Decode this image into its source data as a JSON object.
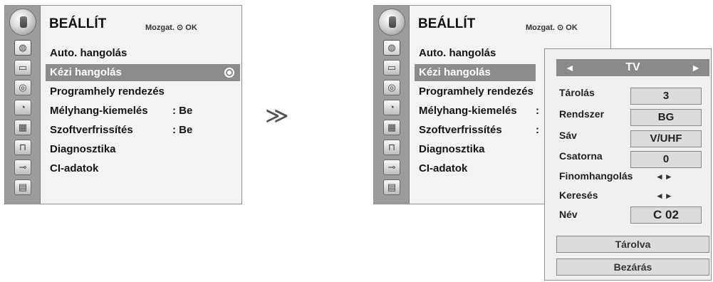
{
  "left_menu": {
    "title": "BEÁLLÍT",
    "hint": "Mozgat. ⊙ OK",
    "items": [
      {
        "label": "Auto. hangolás",
        "value": ""
      },
      {
        "label": "Kézi hangolás",
        "value": ""
      },
      {
        "label": "Programhely rendezés",
        "value": ""
      },
      {
        "label": "Mélyhang-kiemelés",
        "value": ": Be"
      },
      {
        "label": "Szoftverfrissítés",
        "value": ": Be"
      },
      {
        "label": "Diagnosztika",
        "value": ""
      },
      {
        "label": "CI-adatok",
        "value": ""
      }
    ],
    "selected_index": 1,
    "side_icons": [
      "globe-icon",
      "tv-icon",
      "speaker-icon",
      "clock-icon",
      "lock-icon",
      "padlock-icon",
      "plug-icon",
      "picture-icon"
    ]
  },
  "arrow_glyph": "≫",
  "right_menu": {
    "title": "BEÁLLÍT",
    "hint": "Mozgat. ⊙ OK",
    "items": [
      {
        "label": "Auto. hangolás",
        "value": ""
      },
      {
        "label": "Kézi hangolás",
        "value": ""
      },
      {
        "label": "Programhely rendezés",
        "value": ""
      },
      {
        "label": "Mélyhang-kiemelés",
        "value": ":"
      },
      {
        "label": "Szoftverfrissítés",
        "value": ":"
      },
      {
        "label": "Diagnosztika",
        "value": ""
      },
      {
        "label": "CI-adatok",
        "value": ""
      }
    ]
  },
  "popup": {
    "header": {
      "left": "◄",
      "center": "TV",
      "right": "►"
    },
    "fields": [
      {
        "label": "Tárolás",
        "value": "3"
      },
      {
        "label": "Rendszer",
        "value": "BG"
      },
      {
        "label": "Sáv",
        "value": "V/UHF"
      },
      {
        "label": "Csatorna",
        "value": "0"
      },
      {
        "label": "Finomhangolás",
        "value": "◄►"
      },
      {
        "label": "Keresés",
        "value": "◄►"
      },
      {
        "label": "Név",
        "value": "C 02"
      }
    ],
    "store_button": "Tárolva",
    "close_button": "Bezárás"
  },
  "colors": {
    "sidebar": "#9c9c9c",
    "selected_row": "#8c8c8c",
    "menu_bg": "#f3f3f3"
  }
}
